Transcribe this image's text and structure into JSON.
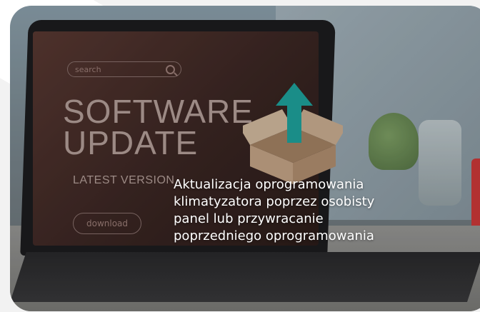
{
  "screen": {
    "search_placeholder": "search",
    "title_line1": "SOFTWARE",
    "title_line2": "UPDATE",
    "subtitle": "LATEST VERSION",
    "download_label": "download"
  },
  "caption": {
    "line1": "Aktualizacja oprogramowania",
    "line2": "klimatyzatora poprzez osobisty",
    "line3": "panel lub przywracanie",
    "line4": "poprzedniego oprogramowania"
  },
  "colors": {
    "arrow": "#1fa6a0",
    "box": "#c9a98a",
    "cup": "#d23a3a"
  }
}
